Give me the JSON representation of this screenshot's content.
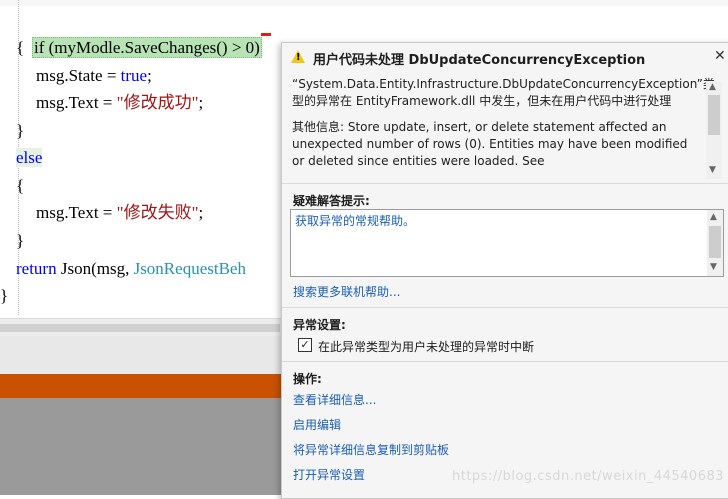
{
  "editor": {
    "lines": {
      "if_prefix": "if (myModle.SaveChanges() > 0)",
      "open_brace": "{",
      "close_brace": "}",
      "state_obj": "msg.State = ",
      "state_val": "true",
      "state_end": ";",
      "text_obj": "msg.Text = ",
      "success_str": "\"修改成功\"",
      "text_end": ";",
      "else_kw": "else",
      "fail_str": "\"修改失败\"",
      "return_kw": "return",
      "return_mid": " Json(msg, ",
      "return_cls": "JsonRequestBeh",
      "final_brace": "}"
    }
  },
  "popup": {
    "title": "用户代码未处理 DbUpdateConcurrencyException",
    "close_glyph": "✕",
    "message": "“System.Data.Entity.Infrastructure.DbUpdateConcurrencyException”类型的异常在 EntityFramework.dll 中发生，但未在用户代码中进行处理",
    "additional_info": "其他信息: Store update, insert, or delete statement affected an unexpected number of rows (0). Entities may have been modified or deleted since entities were loaded. See",
    "troubleshooting_title": "疑难解答提示:",
    "troubleshooting_link": "获取异常的常规帮助。",
    "search_link": "搜索更多联机帮助...",
    "settings_title": "异常设置:",
    "break_checkbox_label": "在此异常类型为用户未处理的异常时中断",
    "break_checked": true,
    "actions_title": "操作:",
    "actions": [
      "查看详细信息...",
      "启用编辑",
      "将异常详细信息复制到剪贴板",
      "打开异常设置"
    ],
    "watermark": "https://blog.csdn.net/weixin_44540683"
  },
  "colors": {
    "keyword": "#0000ff",
    "string": "#a31515",
    "type": "#2b91af",
    "highlight": "#b7e3b5",
    "status_bar": "#ca5100",
    "link": "#1a5fb4",
    "warning": "#f2c811"
  },
  "icons": {
    "warning": "warning-triangle-icon",
    "close": "close-icon",
    "checkbox": "checkbox-checked-icon"
  }
}
